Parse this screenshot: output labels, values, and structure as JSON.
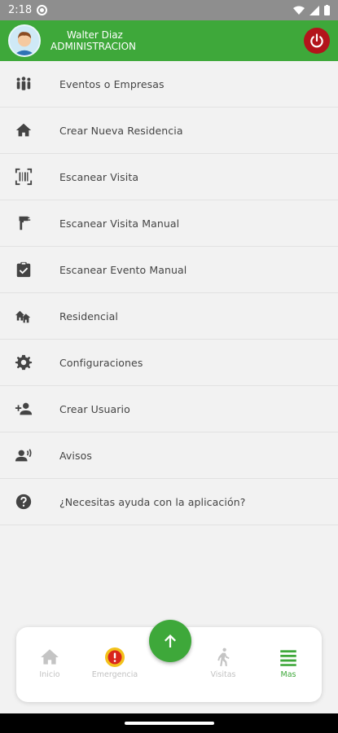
{
  "status_bar": {
    "time": "2:18"
  },
  "header": {
    "user_name": "Walter Diaz",
    "user_role": "ADMINISTRACION"
  },
  "menu": [
    {
      "icon": "people-icon",
      "label": "Eventos o Empresas"
    },
    {
      "icon": "home-icon",
      "label": "Crear Nueva Residencia"
    },
    {
      "icon": "qr-scan-icon",
      "label": "Escanear Visita"
    },
    {
      "icon": "handheld-scanner-icon",
      "label": "Escanear Visita Manual"
    },
    {
      "icon": "clipboard-check-icon",
      "label": "Escanear Evento Manual"
    },
    {
      "icon": "houses-icon",
      "label": "Residencial"
    },
    {
      "icon": "gear-icon",
      "label": "Configuraciones"
    },
    {
      "icon": "add-user-icon",
      "label": "Crear Usuario"
    },
    {
      "icon": "announcement-icon",
      "label": "Avisos"
    },
    {
      "icon": "help-icon",
      "label": "¿Necesitas ayuda con la aplicación?"
    }
  ],
  "bottom_nav": {
    "inicio": "Inicio",
    "emergencia": "Emergencia",
    "visitas": "Visitas",
    "mas": "Mas"
  },
  "colors": {
    "accent": "#3ea83a",
    "danger": "#b3141b",
    "status_bar": "#8e8e8e"
  }
}
